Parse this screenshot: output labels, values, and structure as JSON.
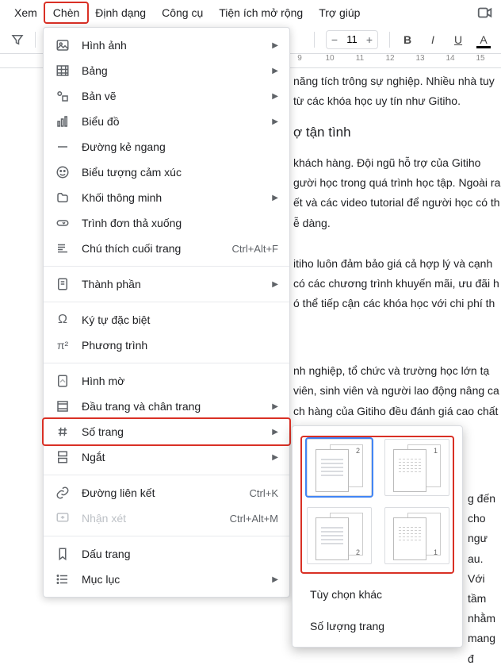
{
  "menubar": {
    "items": [
      "Xem",
      "Chèn",
      "Định dạng",
      "Công cụ",
      "Tiện ích mở rộng",
      "Trợ giúp"
    ],
    "active_index": 1
  },
  "toolbar": {
    "font_size": "11"
  },
  "ruler": {
    "labels": [
      "9",
      "10",
      "11",
      "12",
      "13",
      "14",
      "15"
    ]
  },
  "document": {
    "line1": "năng tích trông sự nghiệp. Nhiều nhà tuy",
    "line2": "từ các khóa học uy tín như Gitiho.",
    "heading1": "ợ tận tình",
    "para1": "khách hàng. Đội ngũ hỗ trợ của Gitiho gười học trong quá trình học tập. Ngoài ra ết và các video tutorial để người học có th ễ dàng.",
    "para2": "itiho luôn đảm bảo giá cả hợp lý và cạnh có các chương trình khuyến mãi, ưu đãi h ó thể tiếp cận các khóa học với chi phí th",
    "para3": "nh nghiệp, tổ chức và trường học lớn tạ viên, sinh viên và người lao động nâng ca ch hàng của Gitiho đều đánh giá cao chất g này.",
    "para4": "g đến cho ngư au. Với tầm nhằm mang đ"
  },
  "dropdown": {
    "items": [
      {
        "icon": "image",
        "label": "Hình ảnh",
        "arrow": true
      },
      {
        "icon": "table",
        "label": "Bảng",
        "arrow": true
      },
      {
        "icon": "drawing",
        "label": "Bản vẽ",
        "arrow": true
      },
      {
        "icon": "chart",
        "label": "Biểu đồ",
        "arrow": true
      },
      {
        "icon": "hr",
        "label": "Đường kẻ ngang"
      },
      {
        "icon": "emoji",
        "label": "Biểu tượng cảm xúc"
      },
      {
        "icon": "smartchip",
        "label": "Khối thông minh",
        "arrow": true
      },
      {
        "icon": "dropdown",
        "label": "Trình đơn thả xuống"
      },
      {
        "icon": "footnote",
        "label": "Chú thích cuối trang",
        "shortcut": "Ctrl+Alt+F"
      },
      {
        "divider": true
      },
      {
        "icon": "building",
        "label": "Thành phần",
        "arrow": true
      },
      {
        "divider": true
      },
      {
        "icon": "omega",
        "label": "Ký tự đặc biệt"
      },
      {
        "icon": "pi",
        "label": "Phương trình"
      },
      {
        "divider": true
      },
      {
        "icon": "watermark",
        "label": "Hình mờ"
      },
      {
        "icon": "headerfooter",
        "label": "Đầu trang và chân trang",
        "arrow": true
      },
      {
        "icon": "hash",
        "label": "Số trang",
        "arrow": true,
        "boxed": true
      },
      {
        "icon": "break",
        "label": "Ngắt",
        "arrow": true
      },
      {
        "divider": true
      },
      {
        "icon": "link",
        "label": "Đường liên kết",
        "shortcut": "Ctrl+K"
      },
      {
        "icon": "comment",
        "label": "Nhận xét",
        "shortcut": "Ctrl+Alt+M",
        "disabled": true
      },
      {
        "divider": true
      },
      {
        "icon": "bookmark",
        "label": "Dấu trang"
      },
      {
        "icon": "toc",
        "label": "Mục lục",
        "arrow": true
      }
    ]
  },
  "submenu": {
    "more_options": "Tùy chọn khác",
    "page_count": "Số lượng trang"
  }
}
